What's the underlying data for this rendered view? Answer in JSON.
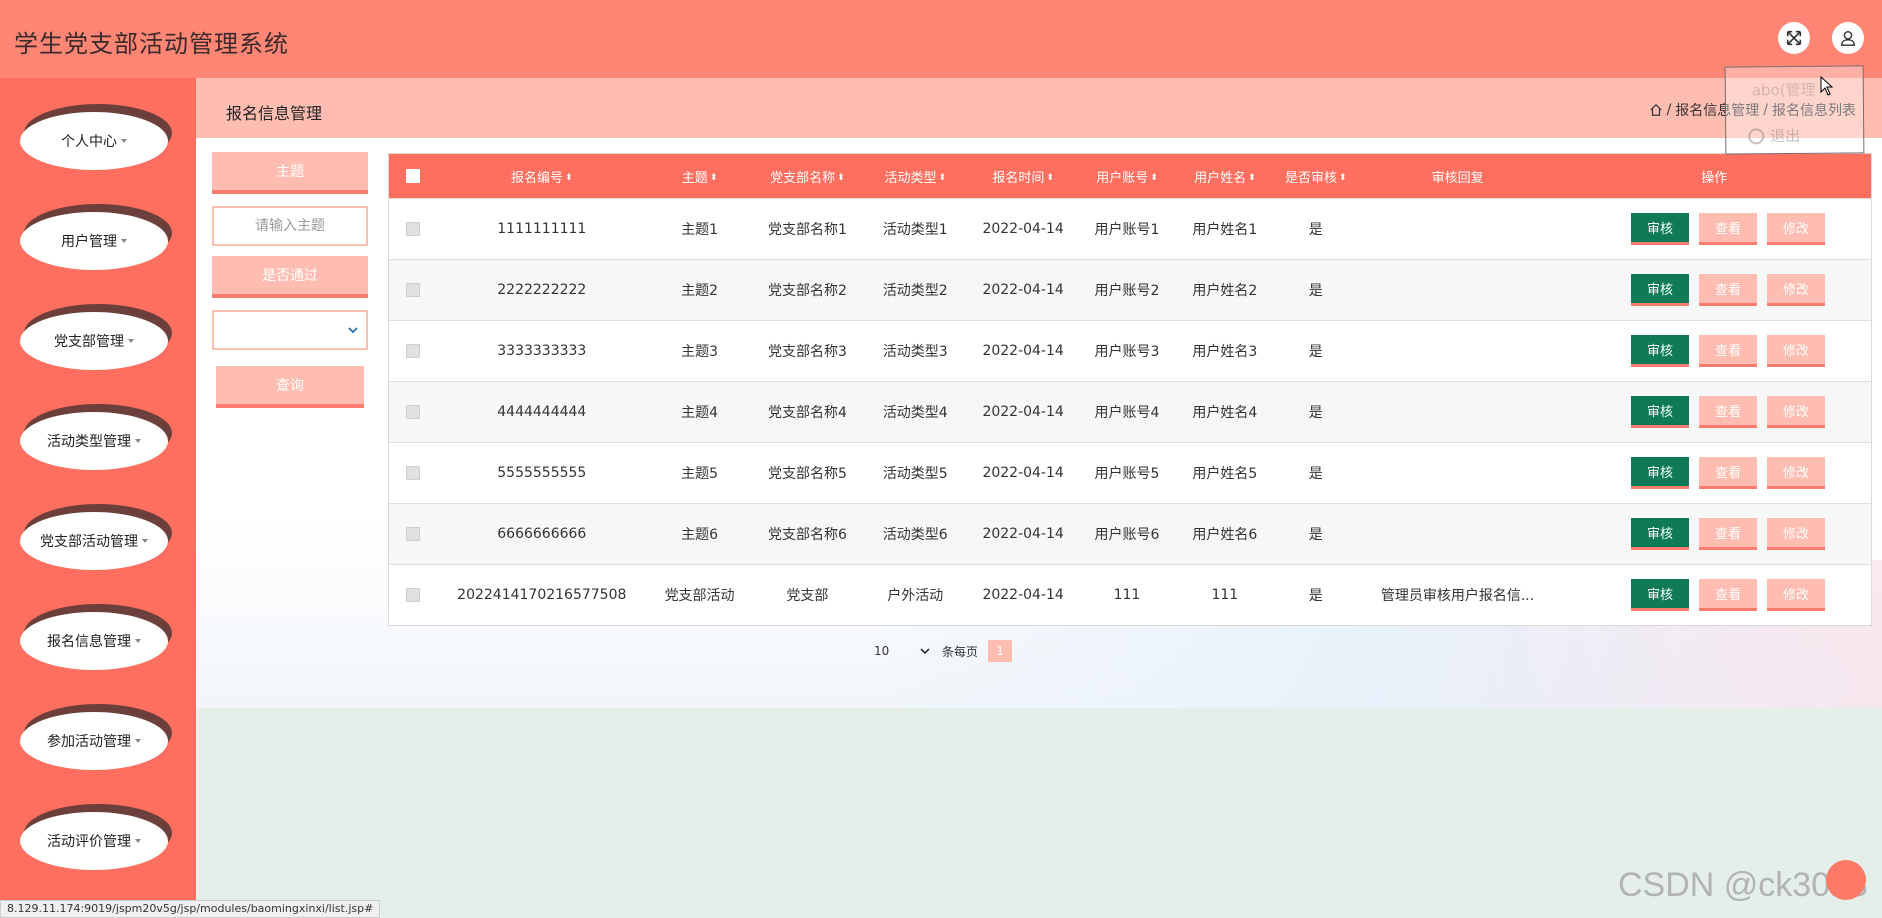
{
  "app": {
    "title": "学生党支部活动管理系统"
  },
  "header": {
    "fullscreen_icon": "fullscreen-icon",
    "user_icon": "user-icon"
  },
  "user_menu": {
    "name": "abo(管理",
    "logout": "退出"
  },
  "sidebar": {
    "items": [
      {
        "label": "个人中心"
      },
      {
        "label": "用户管理"
      },
      {
        "label": "党支部管理"
      },
      {
        "label": "活动类型管理"
      },
      {
        "label": "党支部活动管理"
      },
      {
        "label": "报名信息管理"
      },
      {
        "label": "参加活动管理"
      },
      {
        "label": "活动评价管理"
      }
    ]
  },
  "page": {
    "title": "报名信息管理",
    "breadcrumb": [
      "报名信息管理",
      "报名信息列表"
    ],
    "breadcrumb_sep": "/"
  },
  "search": {
    "subject_label": "主题",
    "subject_placeholder": "请输入主题",
    "passed_label": "是否通过",
    "passed_value": "",
    "query_button": "查询"
  },
  "table": {
    "columns": [
      "报名编号",
      "主题",
      "党支部名称",
      "活动类型",
      "报名时间",
      "用户账号",
      "用户姓名",
      "是否审核",
      "审核回复",
      "操作"
    ],
    "sortable": [
      true,
      true,
      true,
      true,
      true,
      true,
      true,
      true,
      false,
      false
    ],
    "sort_glyph": "⬍",
    "actions": {
      "audit": "审核",
      "view": "查看",
      "edit": "修改"
    },
    "rows": [
      [
        "1111111111",
        "主题1",
        "党支部名称1",
        "活动类型1",
        "2022-04-14",
        "用户账号1",
        "用户姓名1",
        "是",
        ""
      ],
      [
        "2222222222",
        "主题2",
        "党支部名称2",
        "活动类型2",
        "2022-04-14",
        "用户账号2",
        "用户姓名2",
        "是",
        ""
      ],
      [
        "3333333333",
        "主题3",
        "党支部名称3",
        "活动类型3",
        "2022-04-14",
        "用户账号3",
        "用户姓名3",
        "是",
        ""
      ],
      [
        "4444444444",
        "主题4",
        "党支部名称4",
        "活动类型4",
        "2022-04-14",
        "用户账号4",
        "用户姓名4",
        "是",
        ""
      ],
      [
        "5555555555",
        "主题5",
        "党支部名称5",
        "活动类型5",
        "2022-04-14",
        "用户账号5",
        "用户姓名5",
        "是",
        ""
      ],
      [
        "6666666666",
        "主题6",
        "党支部名称6",
        "活动类型6",
        "2022-04-14",
        "用户账号6",
        "用户姓名6",
        "是",
        ""
      ],
      [
        "2022414170216577508",
        "党支部活动",
        "党支部",
        "户外活动",
        "2022-04-14",
        "111",
        "111",
        "是",
        "管理员审核用户报名信..."
      ]
    ]
  },
  "pagination": {
    "page_size": "10",
    "per_page_label": "条每页",
    "current_page": "1"
  },
  "status_bar": {
    "url": "8.129.11.174:9019/jspm20v5g/jsp/modules/baomingxinxi/list.jsp#"
  },
  "watermark": "CSDN @ck3018",
  "colors": {
    "header": "#ff8575",
    "sidebar": "#ff6f5f",
    "table_head": "#ff6f5f",
    "pink": "#ffbdb2",
    "audit_button": "#0e7a57"
  }
}
